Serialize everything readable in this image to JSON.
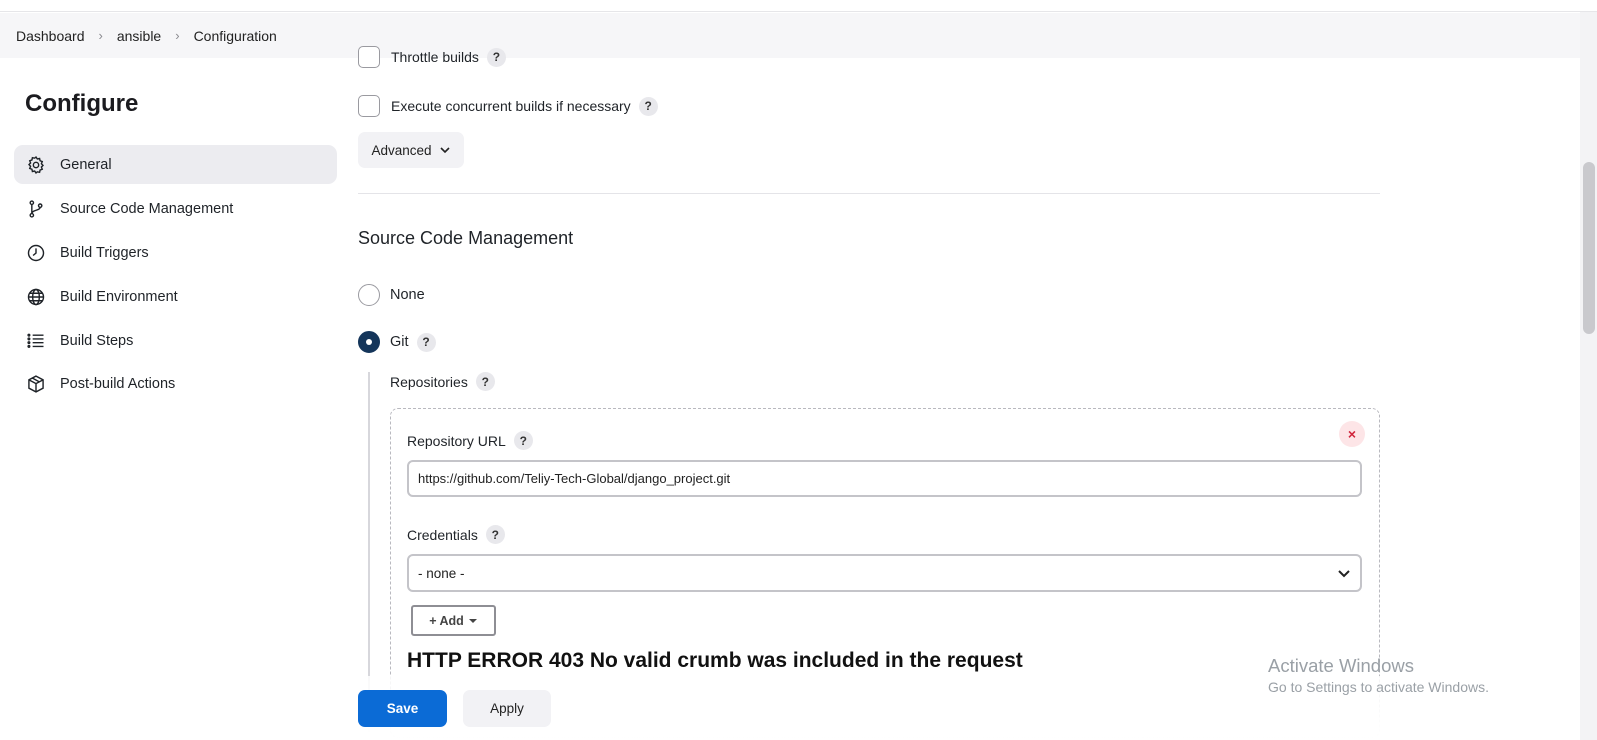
{
  "breadcrumb": {
    "items": [
      "Dashboard",
      "ansible",
      "Configuration"
    ],
    "separator": "›"
  },
  "sidebar": {
    "title": "Configure",
    "items": [
      {
        "label": "General",
        "icon": "gear-icon",
        "active": true
      },
      {
        "label": "Source Code Management",
        "icon": "git-branch-icon",
        "active": false
      },
      {
        "label": "Build Triggers",
        "icon": "clock-icon",
        "active": false
      },
      {
        "label": "Build Environment",
        "icon": "globe-icon",
        "active": false
      },
      {
        "label": "Build Steps",
        "icon": "list-icon",
        "active": false
      },
      {
        "label": "Post-build Actions",
        "icon": "package-icon",
        "active": false
      }
    ]
  },
  "general": {
    "throttle_label": "Throttle builds",
    "concurrent_label": "Execute concurrent builds if necessary",
    "advanced_label": "Advanced"
  },
  "scm": {
    "title": "Source Code Management",
    "options": [
      {
        "label": "None",
        "selected": false
      },
      {
        "label": "Git",
        "selected": true
      }
    ],
    "repositories_label": "Repositories",
    "repo_url_label": "Repository URL",
    "repo_url_value": "https://github.com/Teliy-Tech-Global/django_project.git",
    "credentials_label": "Credentials",
    "credentials_value": "- none -",
    "add_label": "+ Add",
    "error_message": "HTTP ERROR 403 No valid crumb was included in the request"
  },
  "actions": {
    "save_label": "Save",
    "apply_label": "Apply"
  },
  "watermark": {
    "line1": "Activate Windows",
    "line2": "Go to Settings to activate Windows."
  },
  "help_glyph": "?",
  "close_glyph": "×",
  "colors": {
    "primary": "#0b6bd6",
    "radio_selected": "#14355a",
    "danger": "#d0243b"
  }
}
